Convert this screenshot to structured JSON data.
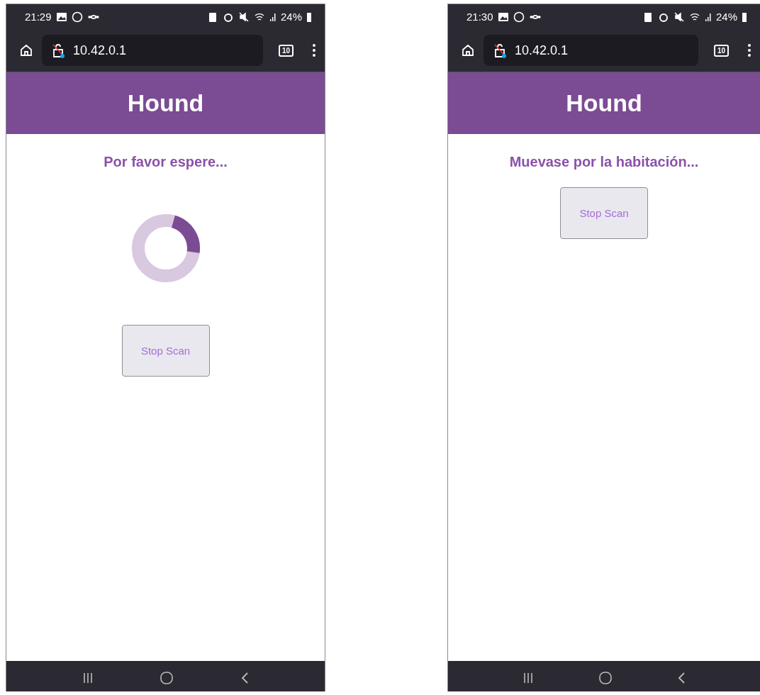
{
  "screens": [
    {
      "status_bar": {
        "time": "21:29",
        "battery": "24%"
      },
      "browser": {
        "url": "10.42.0.1",
        "tab_count": "10"
      },
      "header": {
        "title": "Hound"
      },
      "message": "Por favor espere...",
      "spinner": true,
      "button": "Stop Scan"
    },
    {
      "status_bar": {
        "time": "21:30",
        "battery": "24%"
      },
      "browser": {
        "url": "10.42.0.1",
        "tab_count": "10"
      },
      "header": {
        "title": "Hound"
      },
      "message": "Muevase por la habitación...",
      "spinner": false,
      "button": "Stop Scan"
    }
  ]
}
